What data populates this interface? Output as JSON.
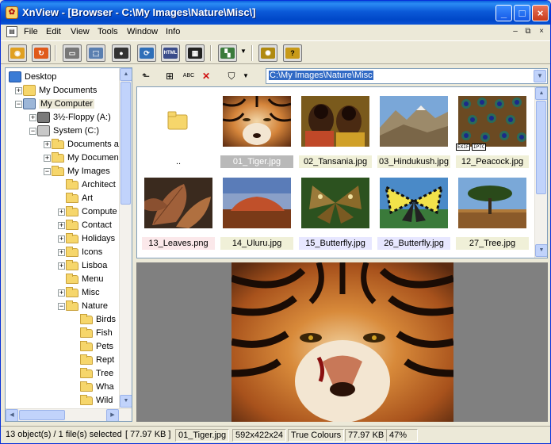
{
  "window": {
    "title": "XnView - [Browser - C:\\My Images\\Nature\\Misc\\]"
  },
  "title_controls": {
    "minimize": "_",
    "maximize": "□",
    "close": "×"
  },
  "menu": {
    "items": [
      "File",
      "Edit",
      "View",
      "Tools",
      "Window",
      "Info"
    ]
  },
  "mdi_controls": {
    "minimize": "–",
    "restore": "⧉",
    "close": "×"
  },
  "toolbar": {
    "buttons": [
      "view-icon",
      "refresh-icon",
      "print-icon",
      "scan-icon",
      "camera-icon",
      "convert-icon",
      "html-icon",
      "contact-sheet-icon",
      "slideshow-icon",
      "settings-icon",
      "help-icon"
    ],
    "html_label": "HTML",
    "help_label": "?"
  },
  "tree": {
    "items": [
      {
        "label": "Desktop",
        "level": 0,
        "expander": "",
        "icon": "desktop-icon"
      },
      {
        "label": "My Documents",
        "level": 1,
        "expander": "+",
        "icon": "documents-icon"
      },
      {
        "label": "My Computer",
        "level": 1,
        "expander": "−",
        "icon": "computer-icon",
        "highlight": true
      },
      {
        "label": "3½-Floppy (A:)",
        "level": 2,
        "expander": "+",
        "icon": "floppy-icon"
      },
      {
        "label": "System (C:)",
        "level": 2,
        "expander": "−",
        "icon": "drive-icon"
      },
      {
        "label": "Documents a",
        "level": 3,
        "expander": "+",
        "icon": "folder-icon"
      },
      {
        "label": "My Documen",
        "level": 3,
        "expander": "+",
        "icon": "folder-icon"
      },
      {
        "label": "My Images",
        "level": 3,
        "expander": "−",
        "icon": "folder-icon"
      },
      {
        "label": "Architect",
        "level": 4,
        "expander": "",
        "icon": "folder-icon"
      },
      {
        "label": "Art",
        "level": 4,
        "expander": "",
        "icon": "folder-icon"
      },
      {
        "label": "Compute",
        "level": 4,
        "expander": "+",
        "icon": "folder-icon"
      },
      {
        "label": "Contact",
        "level": 4,
        "expander": "+",
        "icon": "folder-icon"
      },
      {
        "label": "Holidays",
        "level": 4,
        "expander": "+",
        "icon": "folder-icon"
      },
      {
        "label": "Icons",
        "level": 4,
        "expander": "+",
        "icon": "folder-icon"
      },
      {
        "label": "Lisboa",
        "level": 4,
        "expander": "+",
        "icon": "folder-icon"
      },
      {
        "label": "Menu",
        "level": 4,
        "expander": "",
        "icon": "folder-icon"
      },
      {
        "label": "Misc",
        "level": 4,
        "expander": "+",
        "icon": "folder-icon"
      },
      {
        "label": "Nature",
        "level": 4,
        "expander": "−",
        "icon": "folder-icon"
      },
      {
        "label": "Birds",
        "level": 5,
        "expander": "",
        "icon": "folder-icon"
      },
      {
        "label": "Fish",
        "level": 5,
        "expander": "",
        "icon": "folder-icon"
      },
      {
        "label": "Pets",
        "level": 5,
        "expander": "",
        "icon": "folder-icon"
      },
      {
        "label": "Rept",
        "level": 5,
        "expander": "",
        "icon": "folder-icon"
      },
      {
        "label": "Tree",
        "level": 5,
        "expander": "",
        "icon": "folder-icon"
      },
      {
        "label": "Wha",
        "level": 5,
        "expander": "",
        "icon": "folder-icon"
      },
      {
        "label": "Wild",
        "level": 5,
        "expander": "",
        "icon": "folder-icon"
      }
    ]
  },
  "browser_toolbar": {
    "buttons": [
      "parent-folder-icon",
      "new-folder-icon",
      "rename-icon",
      "delete-icon",
      "filter-icon"
    ],
    "rename_label": "ABC"
  },
  "address": {
    "value": "C:\\My Images\\Nature\\Misc"
  },
  "thumbnails": [
    {
      "caption": "..",
      "kind": "parent"
    },
    {
      "caption": "01_Tiger.jpg",
      "kind": "tiger",
      "selected": true
    },
    {
      "caption": "02_Tansania.jpg",
      "kind": "tansania"
    },
    {
      "caption": "03_Hindukush.jpg",
      "kind": "hindukush"
    },
    {
      "caption": "12_Peacock.jpg",
      "kind": "peacock",
      "badges": [
        "EXIF",
        "IPTC"
      ]
    },
    {
      "caption": "13_Leaves.png",
      "kind": "leaves",
      "png": true
    },
    {
      "caption": "14_Uluru.jpg",
      "kind": "uluru"
    },
    {
      "caption": "15_Butterfly.jpg",
      "kind": "butterfly1",
      "blue": true
    },
    {
      "caption": "26_Butterfly.jpg",
      "kind": "butterfly2",
      "blue": true
    },
    {
      "caption": "27_Tree.jpg",
      "kind": "tree"
    }
  ],
  "status": {
    "selection": "13 object(s) / 1 file(s) selected",
    "selection_size": "[ 77.97 KB ]",
    "filename": "01_Tiger.jpg",
    "dimensions": "592x422x24",
    "colours": "True Colours",
    "file_size": "77.97 KB",
    "zoom": "47%"
  },
  "colors": {
    "title_blue": "#0054e3",
    "selection": "#316ac5",
    "preview_bg": "#808080"
  }
}
